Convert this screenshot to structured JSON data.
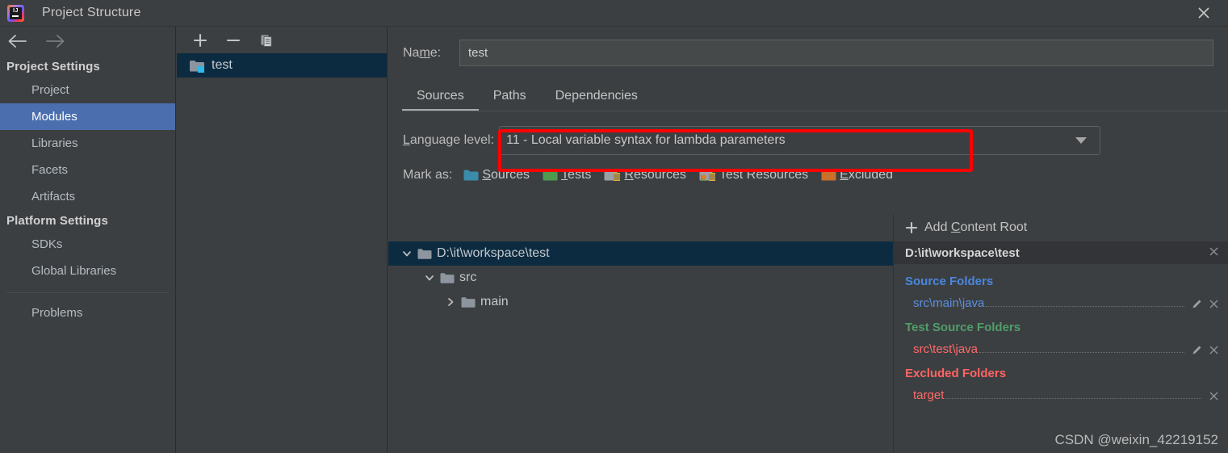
{
  "window": {
    "title": "Project Structure",
    "app_icon": "intellij-idea-logo",
    "close_icon": "close-icon"
  },
  "nav_toolbar": {
    "back_icon": "arrow-left-icon",
    "forward_icon": "arrow-right-icon"
  },
  "sidebar": {
    "groups": [
      {
        "title": "Project Settings",
        "items": [
          {
            "label": "Project",
            "selected": false
          },
          {
            "label": "Modules",
            "selected": true
          },
          {
            "label": "Libraries",
            "selected": false
          },
          {
            "label": "Facets",
            "selected": false
          },
          {
            "label": "Artifacts",
            "selected": false
          }
        ]
      },
      {
        "title": "Platform Settings",
        "items": [
          {
            "label": "SDKs",
            "selected": false
          },
          {
            "label": "Global Libraries",
            "selected": false
          }
        ]
      }
    ],
    "extra_items": [
      {
        "label": "Problems",
        "selected": false
      }
    ]
  },
  "module_panel": {
    "toolbar": {
      "add_icon": "plus-icon",
      "remove_icon": "minus-icon",
      "copy_icon": "copy-icon"
    },
    "modules": [
      {
        "name": "test",
        "icon": "module-folder-icon",
        "selected": true
      }
    ]
  },
  "main": {
    "name_field": {
      "label": "Name:",
      "label_mnemonic": "m",
      "value": "test"
    },
    "tabs": [
      {
        "label": "Sources",
        "active": true
      },
      {
        "label": "Paths",
        "active": false
      },
      {
        "label": "Dependencies",
        "active": false
      }
    ],
    "language_level": {
      "label": "Language level:",
      "label_mnemonic": "L",
      "value": "11 - Local variable syntax for lambda parameters",
      "dropdown_icon": "chevron-down-icon",
      "highlight_color": "#ff0000"
    },
    "mark_as": {
      "label": "Mark as:",
      "options": [
        {
          "label": "Sources",
          "mnemonic": "S",
          "color": "#3b8bab",
          "icon": "folder-sources-icon"
        },
        {
          "label": "Tests",
          "mnemonic": "T",
          "color": "#4e9a4e",
          "icon": "folder-tests-icon"
        },
        {
          "label": "Resources",
          "mnemonic": "R",
          "color": "#9aa0a6",
          "icon": "folder-resources-icon"
        },
        {
          "label": "Test Resources",
          "mnemonic": "",
          "color": "#9aa0a6",
          "icon": "folder-test-resources-icon"
        },
        {
          "label": "Excluded",
          "mnemonic": "E",
          "color": "#c9702b",
          "icon": "folder-excluded-icon"
        }
      ]
    },
    "tree": [
      {
        "label": "D:\\it\\workspace\\test",
        "depth": 0,
        "expanded": true,
        "selected": true,
        "icon": "folder-icon"
      },
      {
        "label": "src",
        "depth": 1,
        "expanded": true,
        "selected": false,
        "icon": "folder-icon"
      },
      {
        "label": "main",
        "depth": 2,
        "expanded": false,
        "selected": false,
        "icon": "folder-icon"
      }
    ]
  },
  "detail_panel": {
    "add_content_root": {
      "label": "Add Content Root",
      "mnemonic": "C",
      "icon": "plus-icon"
    },
    "content_root": {
      "path": "D:\\it\\workspace\\test",
      "remove_icon": "close-icon"
    },
    "groups": [
      {
        "title": "Source Folders",
        "title_color": "#4a87df",
        "paths": [
          {
            "path": "src\\main\\java",
            "color": "#5c8fe0",
            "edit_icon": "pencil-icon",
            "remove_icon": "close-icon"
          }
        ]
      },
      {
        "title": "Test Source Folders",
        "title_color": "#4f9e6a",
        "paths": [
          {
            "path": "src\\test\\java",
            "color": "#ff6a6a",
            "edit_icon": "pencil-icon",
            "remove_icon": "close-icon"
          }
        ]
      },
      {
        "title": "Excluded Folders",
        "title_color": "#ff6565",
        "paths": [
          {
            "path": "target",
            "color": "#ff6a6a",
            "edit_icon": "",
            "remove_icon": "close-icon"
          }
        ]
      }
    ]
  },
  "watermark": {
    "text": "CSDN @weixin_42219152"
  }
}
